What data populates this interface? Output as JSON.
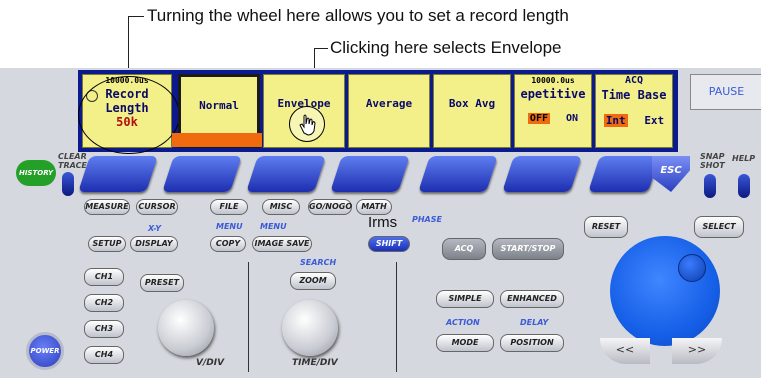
{
  "annotations": {
    "record_length_note": "Turning the wheel here allows you to set a record length",
    "envelope_note": "Clicking here selects Envelope",
    "irms_note": "Irms"
  },
  "screen": {
    "record_length": {
      "header": "10000.0us",
      "label_line1": "Record",
      "label_line2": "Length",
      "value": "50k"
    },
    "softkeys": [
      "Normal",
      "Envelope",
      "Average",
      "Box Avg"
    ],
    "repetitive": {
      "header": "10000.0us",
      "label": "epetitive",
      "off": "OFF",
      "on": "ON"
    },
    "timebase": {
      "header": "ACQ",
      "label": "Time Base",
      "int": "Int",
      "ext": "Ext"
    },
    "pause": "PAUSE"
  },
  "panel": {
    "history": "HISTORY",
    "clear_trace": [
      "CLEAR",
      "TRACE"
    ],
    "snap_shot": [
      "SNAP",
      "SHOT"
    ],
    "help": "HELP",
    "esc": "ESC",
    "row1": [
      "MEASURE",
      "CURSOR",
      "FILE",
      "MISC",
      "GO/NOGO",
      "MATH"
    ],
    "xy_label": "X-Y",
    "menu_label_1": "MENU",
    "menu_label_2": "MENU",
    "phase_label": "PHASE",
    "row2": [
      "SETUP",
      "DISPLAY",
      "COPY",
      "IMAGE SAVE"
    ],
    "shift": "SHIFT",
    "acq": "ACQ",
    "start_stop": "START/STOP",
    "reset": "RESET",
    "select": "SELECT",
    "channels": [
      "CH1",
      "CH2",
      "CH3",
      "CH4"
    ],
    "preset": "PRESET",
    "search": "SEARCH",
    "zoom": "ZOOM",
    "simple": "SIMPLE",
    "enhanced": "ENHANCED",
    "action": "ACTION",
    "delay": "DELAY",
    "mode": "MODE",
    "position": "POSITION",
    "vdiv": "V/DIV",
    "timediv": "TIME/DIV",
    "power": "POWER"
  }
}
